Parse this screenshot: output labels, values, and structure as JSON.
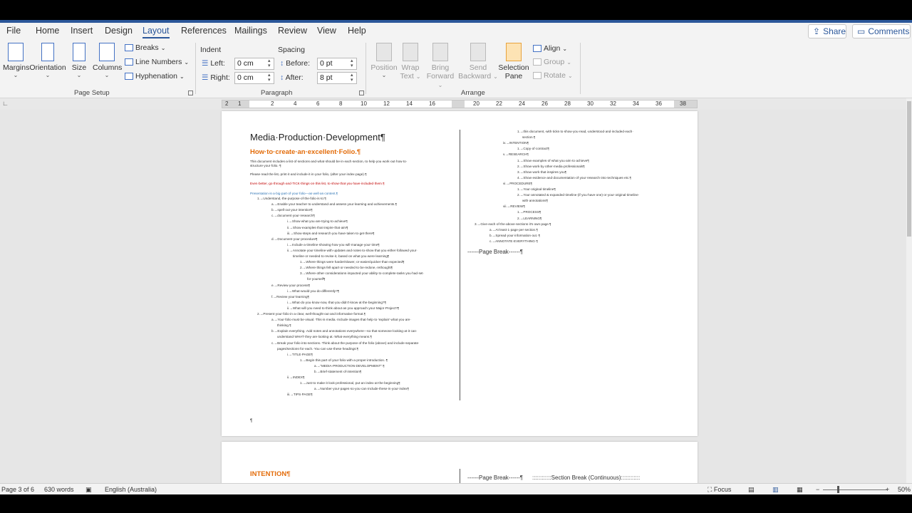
{
  "tabs": [
    "File",
    "Home",
    "Insert",
    "Design",
    "Layout",
    "References",
    "Mailings",
    "Review",
    "View",
    "Help"
  ],
  "active_tab": "Layout",
  "share": {
    "share_label": "Share",
    "comments_label": "Comments"
  },
  "page_setup": {
    "margins": "Margins",
    "orientation": "Orientation",
    "size": "Size",
    "columns": "Columns",
    "breaks": "Breaks",
    "line_numbers": "Line Numbers",
    "hyphenation": "Hyphenation",
    "group_label": "Page Setup"
  },
  "paragraph": {
    "indent_label": "Indent",
    "spacing_label": "Spacing",
    "left_label": "Left:",
    "right_label": "Right:",
    "before_label": "Before:",
    "after_label": "After:",
    "left_value": "0 cm",
    "right_value": "0 cm",
    "before_value": "0 pt",
    "after_value": "8 pt",
    "group_label": "Paragraph"
  },
  "arrange": {
    "position": "Position",
    "wrap1": "Wrap",
    "wrap2": "Text",
    "bring1": "Bring",
    "bring2": "Forward",
    "send1": "Send",
    "send2": "Backward",
    "sel1": "Selection",
    "sel2": "Pane",
    "align": "Align",
    "group": "Group",
    "rotate": "Rotate",
    "group_label": "Arrange"
  },
  "ruler_numbers": [
    "2",
    "1",
    "2",
    "4",
    "6",
    "8",
    "10",
    "12",
    "14",
    "16",
    "20",
    "22",
    "24",
    "26",
    "28",
    "30",
    "32",
    "34",
    "36",
    "38"
  ],
  "doc": {
    "title": "Media·Production·Development¶",
    "heading1": "How·to·create·an·excellent·Folio.¶",
    "intro1": "This·document·includes·a·list·of·sections·and·what·should·be·in·each·section,·to·help·you·work·out·how·to·",
    "intro2": "structure·your·folio.·¶",
    "intro3": "Please·read·the·list,·print·it·and·include·it·in·your·folio,·(after·your·index·page).¶",
    "intro4": "Even·better,·go·through·and·TICK·things·on·this·list,·to·show·that·you·have·included·them.¶",
    "pres": "Presentation·is·a·big·part·of·your·folio—as·well·as·content.¶",
    "left_lines": [
      "1.→Understand,·the·purpose·of·the·folio·is·to:¶",
      "a.→Enable·your·teacher·to·understand·and·assess·your·learning·and·achievements.¶",
      "b.→spell·out·your·intention¶",
      "c.→document·your·research¶",
      "i.→Show·what·you·are·trying·to·achieve¶",
      "ii.→Show·examples·that·inspire·that·aim¶",
      "iii.→Show·steps·and·research·you·have·taken·to·get·there¶",
      "d.→Document·your·procedure¶",
      "i.→Include·a·timeline·showing·how·you·will·manage·your·time¶",
      "ii.→Annotate·your·timeline·with·updates·and·notes·to·show·that·you·either·followed·your·",
      "timeline·or·needed·to·revise·it,·based·on·what·you·were·learning¶",
      "1.→Where·things·were·harder/slower,·or·easier/quicker·than·expected¶",
      "2.→Where·things·fell·apart·or·needed·to·be·redone,·rethought¶",
      "3.→Where·other·considerations·impacted·your·ability·to·complete·tasks·you·had·set·",
      "for·yourself¶",
      "e.→Review·your·process¶",
      "i.→What·would·you·do·differently?¶",
      "f.→Review·your·learning¶",
      "i.→What·do·you·know·now,·that·you·didn't·know·at·the·beginning?¶",
      "ii.→What·will·you·need·to·think·about·as·you·approach·your·Major·Project?¶",
      "2.→Present·your·folio·in·a·clear,·well-thought-out·and·informative·format.¶",
      "a.→Your·folio·must·be·visual.·This·is·media.·Include·images·that·help·to·'explain'·what·you·are·",
      "thinking.¶",
      "b.→Explain·everything.·Add·notes·and·annotations·everywhere—so·that·someone·looking·at·it·can·",
      "understand·WHAT·they·are·looking·at.·What·everything·means.¶",
      "c.→Break·your·folio·into·sections.·Think·about·the·purpose·of·the·folio·(above)·and·include·separate·",
      "pages/sections·for·each.·You·can·use·these·headings:¶",
      "i.→TITLE·PAGE¶",
      "1.→Begin·this·part·of·your·folio·with·a·proper·introduction.·¶",
      "a.→\"MEDIA·PRODUCTION·DEVELOPMENT\".¶",
      "b.→Brief·statement·of·intention¶",
      "ii.→INDEX¶",
      "1.→Just·to·make·it·look·professional,·put·an·index·at·the·beginning¶",
      "a.→Number·your·pages·so·you·can·include·these·in·your·index¶",
      "iii.→TIPS·PAGE¶"
    ],
    "right_lines": [
      "1.→this·document,·with·ticks·to·show·you·read,·understood·and·included·each·",
      "section.¶",
      "iv.→INTENTION¶",
      "1.→Copy·of·contract¶",
      "v.→RESEARCH¶",
      "1.→Show·examples·of·what·you·aim·to·achieve¶",
      "2.→Show·work·by·other·media·professionals¶",
      "3.→Show·work·that·inspires·you¶",
      "4.→Show·evidence·and·documentation·of·your·research·into·techniques·etc.¶",
      "vi.→PROCEDURE¶",
      "1.→Your·original·timeline¶",
      "2.→Your·annotated·&·expanded·timeline·(if·you·have·one)·or·your·original·timeline·",
      "with·annotations¶",
      "vii.→REVIEW¶",
      "1.→PROCESS¶",
      "2.→LEARNING¶",
      "3.→Give·each·of·the·above·sections·it's·own·page.¶",
      "a.→At·least·1·page·per·section.¶",
      "b.→Spread·your·information·out.·¶",
      "c.→ANNOTATE·EVERYTHING·¶"
    ],
    "page_break": "------Page Break------¶",
    "pilcrow": "¶",
    "heading2": "INTENTION¶",
    "page2_break": "------Page Break------¶",
    "section_break": "Section Break (Continuous)"
  },
  "status": {
    "page": "Page 3 of 6",
    "words": "630 words",
    "language": "English (Australia)",
    "focus": "Focus",
    "zoom": "50%"
  },
  "colors": {
    "brand": "#2b579a",
    "heading": "#e36c0a",
    "red_text": "#c00000",
    "blue_text": "#2e74b5"
  }
}
